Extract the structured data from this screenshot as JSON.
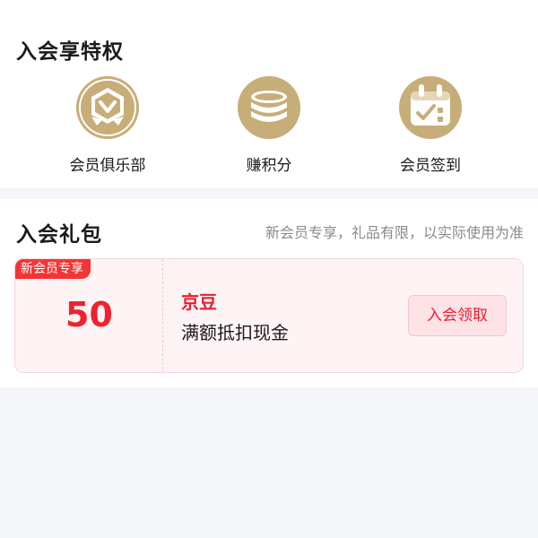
{
  "privileges": {
    "title": "入会享特权",
    "items": [
      {
        "label": "会员俱乐部",
        "icon": "member-club-badge-icon"
      },
      {
        "label": "赚积分",
        "icon": "coin-stack-icon"
      },
      {
        "label": "会员签到",
        "icon": "calendar-checkin-icon"
      }
    ]
  },
  "gift": {
    "title": "入会礼包",
    "note": "新会员专享，礼品有限，以实际使用为准",
    "coupon": {
      "badge": "新会员专享",
      "amount": "50",
      "type": "京豆",
      "desc": "满额抵扣现金",
      "button_label": "入会领取"
    }
  },
  "colors": {
    "accent_red": "#f0222e",
    "gold": "#c7ad78",
    "page_bg": "#f5f6fa"
  }
}
